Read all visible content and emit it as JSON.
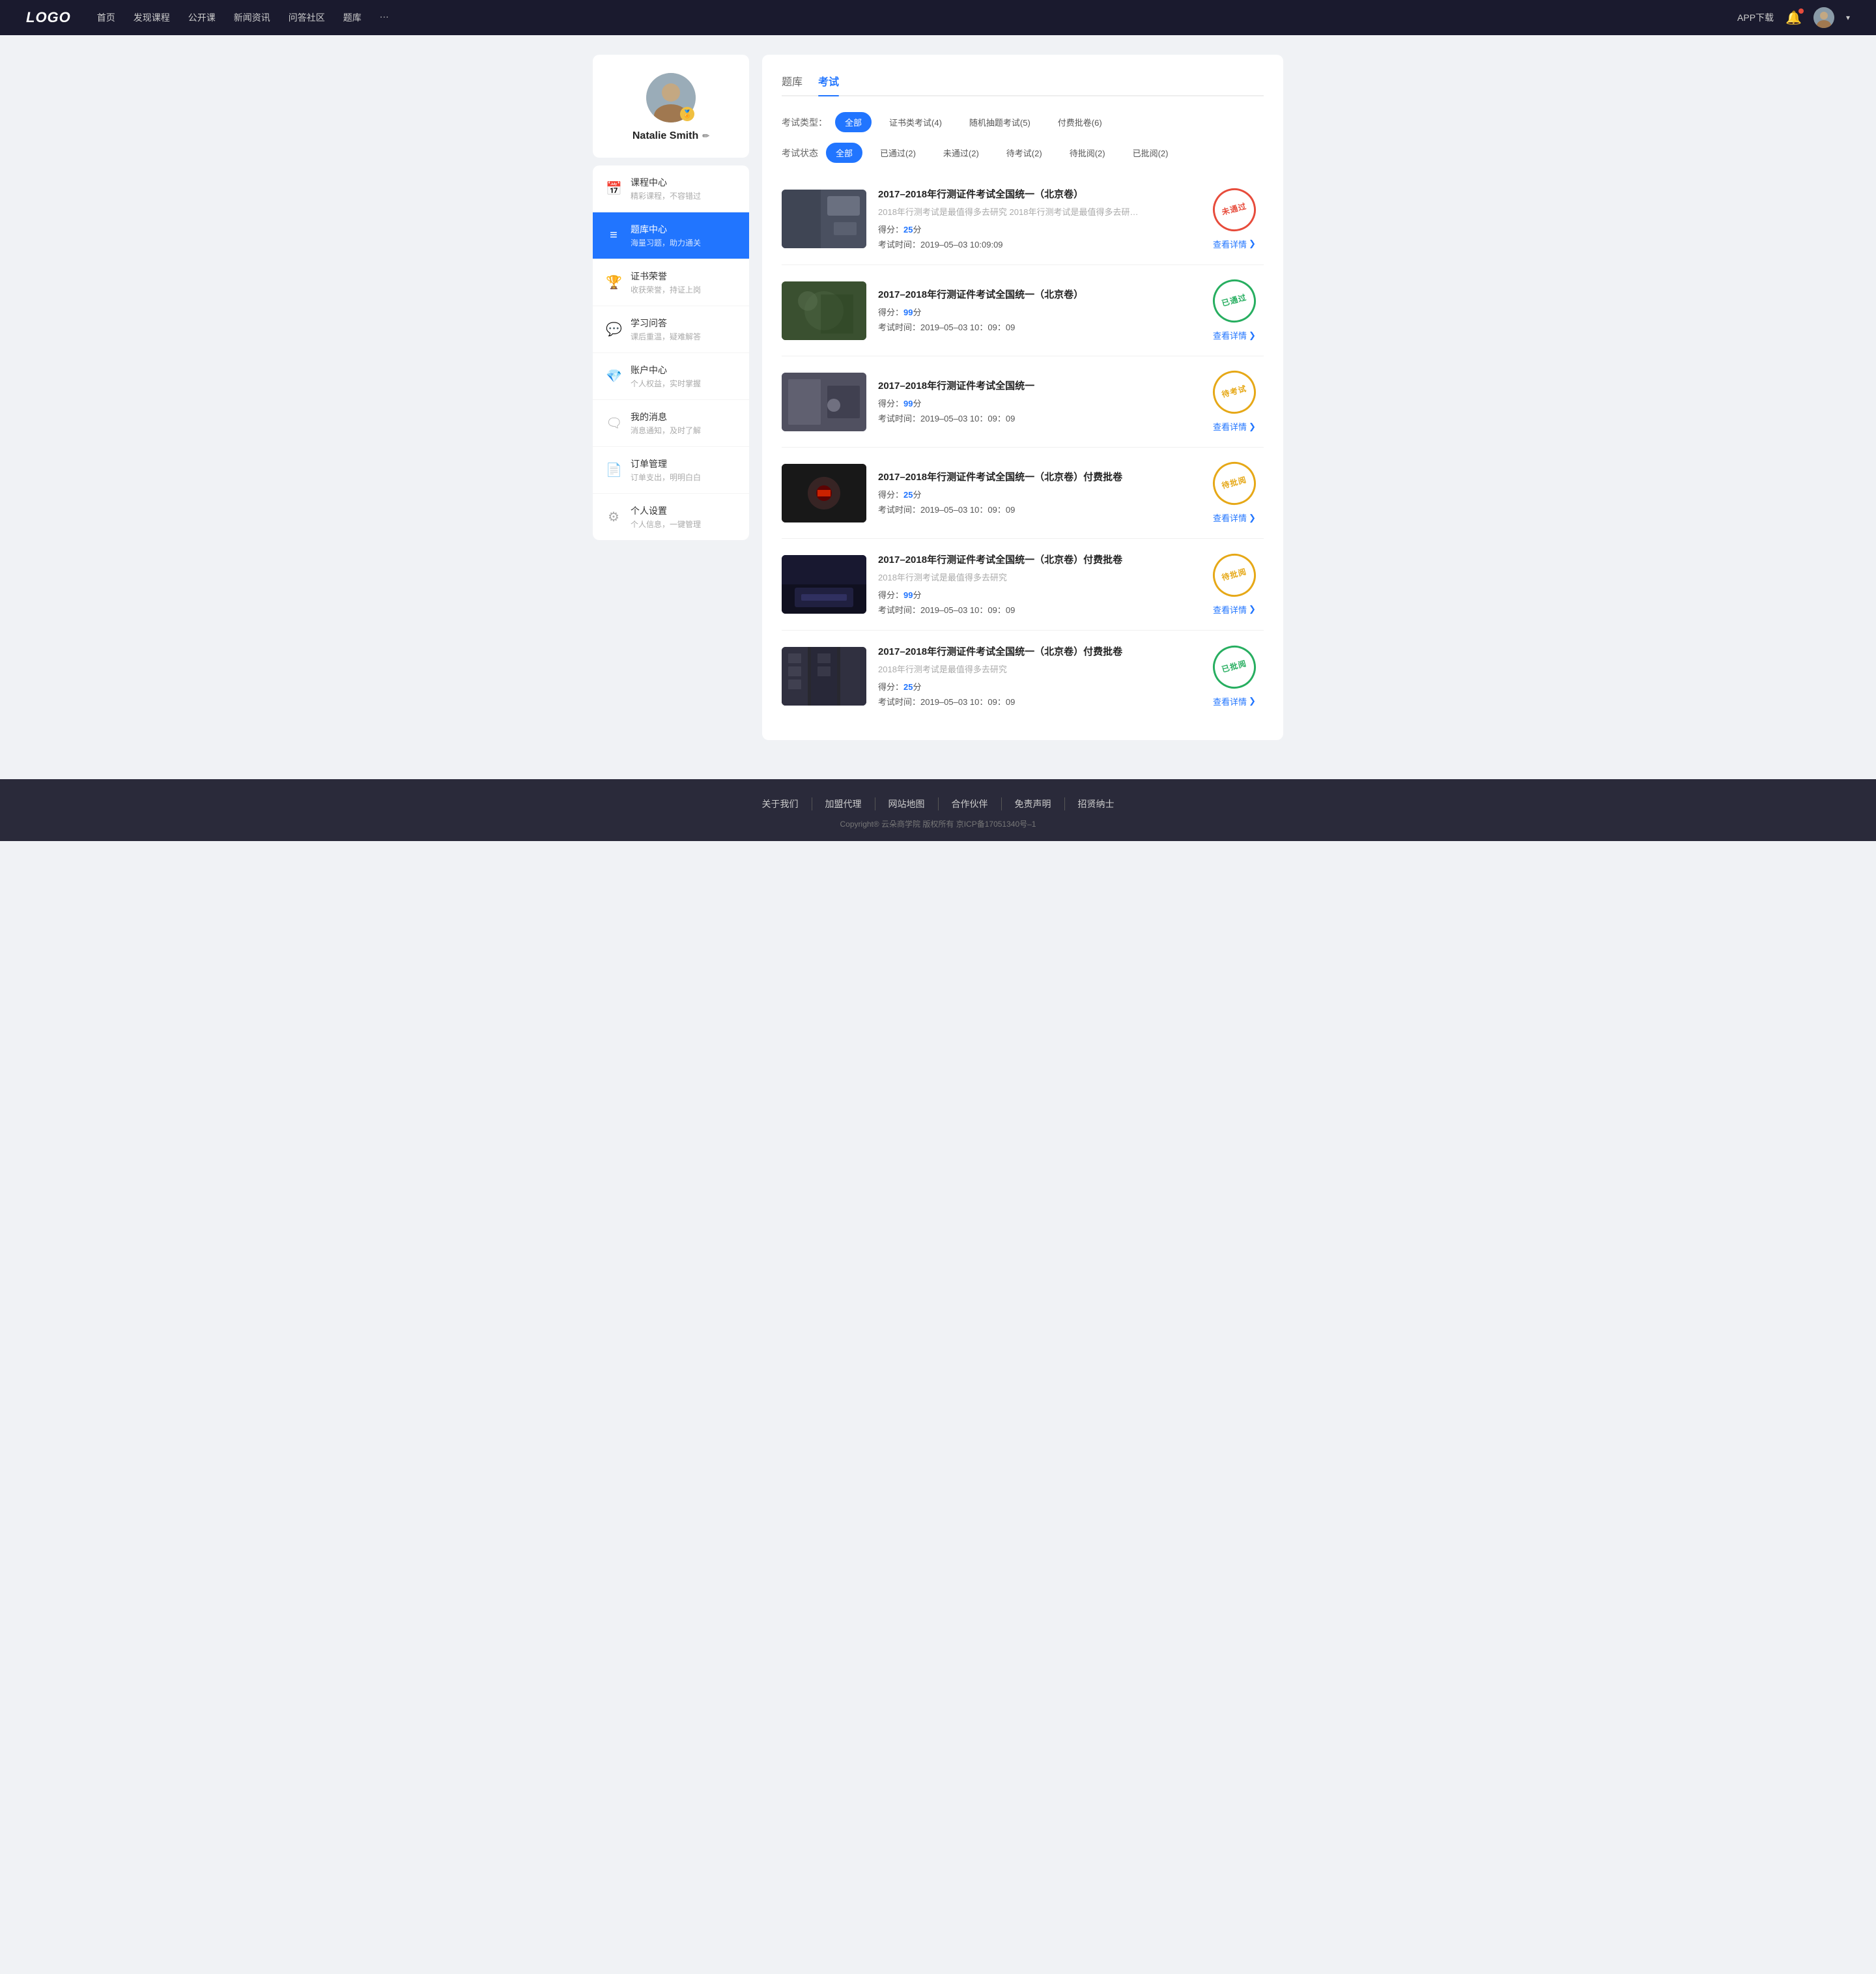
{
  "site": {
    "logo": "LOGO"
  },
  "navbar": {
    "links": [
      {
        "label": "首页",
        "id": "home"
      },
      {
        "label": "发现课程",
        "id": "courses"
      },
      {
        "label": "公开课",
        "id": "open"
      },
      {
        "label": "新闻资讯",
        "id": "news"
      },
      {
        "label": "问答社区",
        "id": "qa"
      },
      {
        "label": "题库",
        "id": "quiz"
      },
      {
        "label": "···",
        "id": "more"
      }
    ],
    "app_download": "APP下载",
    "user_name": "Natalie Smith"
  },
  "sidebar": {
    "profile": {
      "name": "Natalie Smith",
      "edit_tooltip": "编辑"
    },
    "menu": [
      {
        "id": "course-center",
        "icon": "📅",
        "title": "课程中心",
        "subtitle": "精彩课程，不容错过",
        "active": false
      },
      {
        "id": "quiz-center",
        "icon": "📋",
        "title": "题库中心",
        "subtitle": "海量习题，助力通关",
        "active": true
      },
      {
        "id": "certificate",
        "icon": "🏆",
        "title": "证书荣誉",
        "subtitle": "收获荣誉，持证上岗",
        "active": false
      },
      {
        "id": "learning-qa",
        "icon": "💬",
        "title": "学习问答",
        "subtitle": "课后重温，疑难解答",
        "active": false
      },
      {
        "id": "account",
        "icon": "💎",
        "title": "账户中心",
        "subtitle": "个人权益，实时掌握",
        "active": false
      },
      {
        "id": "messages",
        "icon": "🗨",
        "title": "我的消息",
        "subtitle": "消息通知，及时了解",
        "active": false
      },
      {
        "id": "orders",
        "icon": "📄",
        "title": "订单管理",
        "subtitle": "订单支出，明明白白",
        "active": false
      },
      {
        "id": "settings",
        "icon": "⚙",
        "title": "个人设置",
        "subtitle": "个人信息，一键管理",
        "active": false
      }
    ]
  },
  "content": {
    "tabs": [
      {
        "label": "题库",
        "id": "question-bank",
        "active": false
      },
      {
        "label": "考试",
        "id": "exam",
        "active": true
      }
    ],
    "filter_type": {
      "label": "考试类型：",
      "options": [
        {
          "label": "全部",
          "active": true
        },
        {
          "label": "证书类考试(4)",
          "active": false
        },
        {
          "label": "随机抽题考试(5)",
          "active": false
        },
        {
          "label": "付费批卷(6)",
          "active": false
        }
      ]
    },
    "filter_status": {
      "label": "考试状态",
      "options": [
        {
          "label": "全部",
          "active": true
        },
        {
          "label": "已通过(2)",
          "active": false
        },
        {
          "label": "未通过(2)",
          "active": false
        },
        {
          "label": "待考试(2)",
          "active": false
        },
        {
          "label": "待批阅(2)",
          "active": false
        },
        {
          "label": "已批阅(2)",
          "active": false
        }
      ]
    },
    "exam_list": [
      {
        "id": 1,
        "title": "2017–2018年行测证件考试全国统一（北京卷）",
        "desc": "2018年行测考试是最值得多去研究 2018年行测考试是最值得多去研究 2018年行...",
        "score_label": "得分：",
        "score": "25",
        "score_unit": "分",
        "time_label": "考试时间：",
        "time": "2019–05–03  10:09:09",
        "detail_label": "查看详情",
        "status": "未通过",
        "status_type": "not-pass",
        "thumb_class": "thumb-1"
      },
      {
        "id": 2,
        "title": "2017–2018年行测证件考试全国统一（北京卷）",
        "desc": "",
        "score_label": "得分：",
        "score": "99",
        "score_unit": "分",
        "time_label": "考试时间：",
        "time": "2019–05–03  10：09：09",
        "detail_label": "查看详情",
        "status": "已通过",
        "status_type": "passed",
        "thumb_class": "thumb-2"
      },
      {
        "id": 3,
        "title": "2017–2018年行测证件考试全国统一",
        "desc": "",
        "score_label": "得分：",
        "score": "99",
        "score_unit": "分",
        "time_label": "考试时间：",
        "time": "2019–05–03  10：09：09",
        "detail_label": "查看详情",
        "status": "待考试",
        "status_type": "pending",
        "thumb_class": "thumb-3"
      },
      {
        "id": 4,
        "title": "2017–2018年行测证件考试全国统一（北京卷）付费批卷",
        "desc": "",
        "score_label": "得分：",
        "score": "25",
        "score_unit": "分",
        "time_label": "考试时间：",
        "time": "2019–05–03  10：09：09",
        "detail_label": "查看详情",
        "status": "待批阅",
        "status_type": "pending-review",
        "thumb_class": "thumb-4"
      },
      {
        "id": 5,
        "title": "2017–2018年行测证件考试全国统一（北京卷）付费批卷",
        "desc": "2018年行测考试是最值得多去研究",
        "score_label": "得分：",
        "score": "99",
        "score_unit": "分",
        "time_label": "考试时间：",
        "time": "2019–05–03  10：09：09",
        "detail_label": "查看详情",
        "status": "待批阅",
        "status_type": "pending-review",
        "thumb_class": "thumb-5"
      },
      {
        "id": 6,
        "title": "2017–2018年行测证件考试全国统一（北京卷）付费批卷",
        "desc": "2018年行测考试是最值得多去研究",
        "score_label": "得分：",
        "score": "25",
        "score_unit": "分",
        "time_label": "考试时间：",
        "time": "2019–05–03  10：09：09",
        "detail_label": "查看详情",
        "status": "已批阅",
        "status_type": "reviewed",
        "thumb_class": "thumb-6"
      }
    ]
  },
  "footer": {
    "links": [
      {
        "label": "关于我们",
        "id": "about"
      },
      {
        "label": "加盟代理",
        "id": "agent"
      },
      {
        "label": "网站地图",
        "id": "sitemap"
      },
      {
        "label": "合作伙伴",
        "id": "partner"
      },
      {
        "label": "免责声明",
        "id": "disclaimer"
      },
      {
        "label": "招贤纳士",
        "id": "jobs"
      }
    ],
    "copyright": "Copyright® 云朵商学院  版权所有    京ICP备17051340号–1"
  }
}
